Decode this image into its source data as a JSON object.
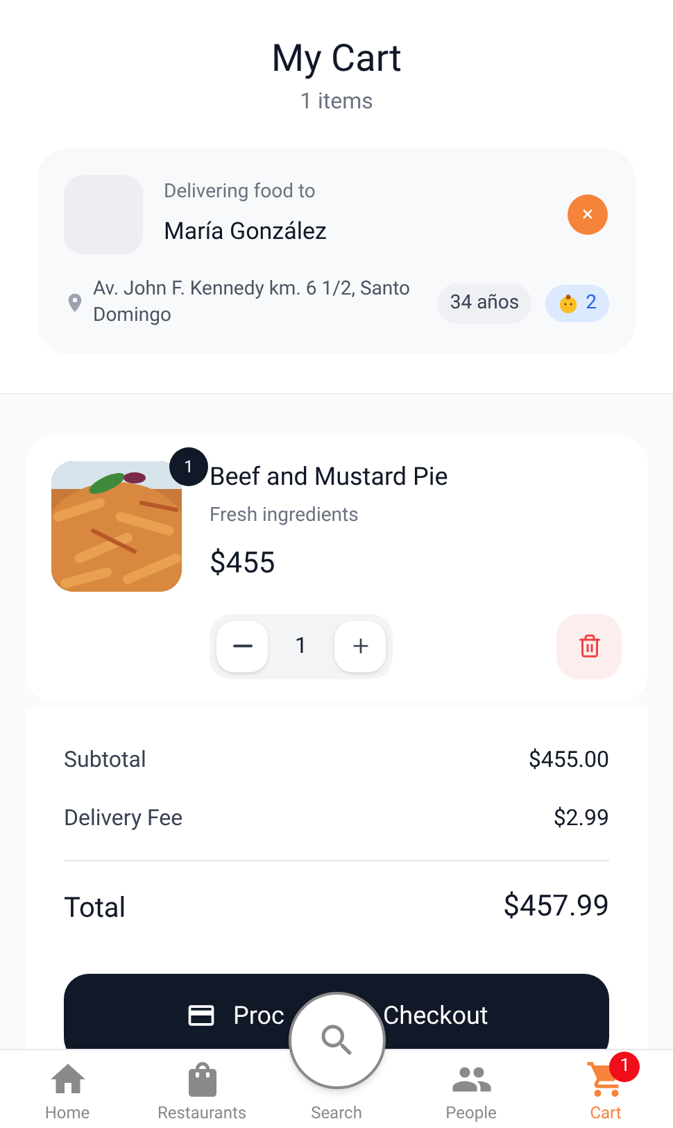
{
  "header": {
    "title": "My Cart",
    "subtitle": "1 items"
  },
  "delivery": {
    "label": "Delivering food to",
    "name": "María González",
    "address": "Av. John F. Kennedy km. 6 1/2, Santo Domingo",
    "age": "34 años",
    "children": "2",
    "close": "×"
  },
  "items": [
    {
      "name": "Beef and Mustard Pie",
      "description": "Fresh ingredients",
      "price": "$455",
      "quantity": "1",
      "badge": "1"
    }
  ],
  "summary": [
    {
      "label": "Subtotal",
      "value": "$455.00"
    },
    {
      "label": "Delivery Fee",
      "value": "$2.99"
    }
  ],
  "total": {
    "label": "Total",
    "value": "$457.99"
  },
  "checkout": {
    "label_start": "Proc",
    "label_end": "Checkout"
  },
  "nav": [
    {
      "kind": "home",
      "label": "Home",
      "selected": false
    },
    {
      "kind": "restaurants",
      "label": "Restaurants",
      "selected": false
    },
    {
      "kind": "search",
      "label": "Search",
      "selected": false
    },
    {
      "kind": "people",
      "label": "People",
      "selected": false
    },
    {
      "kind": "cart",
      "label": "Cart",
      "selected": true,
      "badge": "1"
    }
  ]
}
